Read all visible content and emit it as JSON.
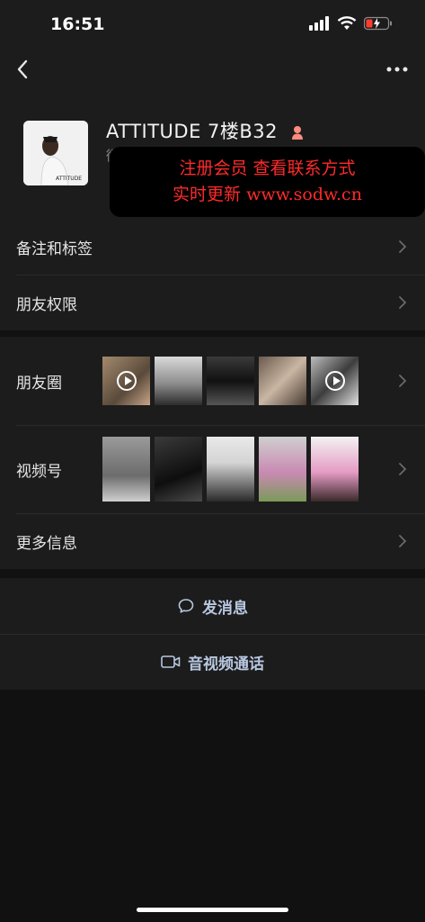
{
  "status_bar": {
    "time": "16:51"
  },
  "profile": {
    "name": "ATTITUDE  7楼B32",
    "sub_text": "微",
    "avatar_text": "ATTITUDE"
  },
  "overlay_ad": {
    "line1": "注册会员 查看联系方式",
    "line2": "实时更新 www.sodw.cn"
  },
  "rows": {
    "remark_tags": "备注和标签",
    "friend_permissions": "朋友权限",
    "moments": "朋友圈",
    "channels": "视频号",
    "more_info": "更多信息"
  },
  "actions": {
    "send_message": "发消息",
    "video_call": "音视频通话"
  },
  "icons": {
    "back": "back-icon",
    "more": "more-icon",
    "chevron": "chevron-right-icon",
    "message": "chat-bubble-icon",
    "video": "video-camera-icon",
    "gender": "female-icon"
  },
  "colors": {
    "background": "#111111",
    "panel": "#1c1c1c",
    "action_text": "#b8c7e0",
    "ad_text": "#ff2a2a"
  }
}
